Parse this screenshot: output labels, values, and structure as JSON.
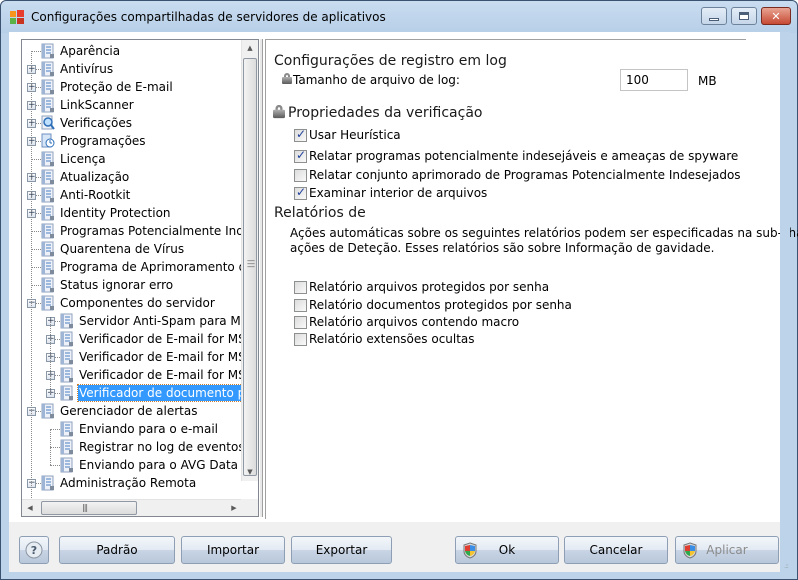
{
  "window": {
    "title": "Configurações compartilhadas de servidores de aplicativos",
    "controls": {
      "minimize": "minimize",
      "maximize": "maximize",
      "close": "close"
    }
  },
  "tree": {
    "items": [
      {
        "label": "Aparência",
        "level": 0,
        "expander": "none",
        "icon": "settings-page-icon"
      },
      {
        "label": "Antivírus",
        "level": 0,
        "expander": "plus",
        "icon": "settings-page-icon"
      },
      {
        "label": "Proteção de E-mail",
        "level": 0,
        "expander": "plus",
        "icon": "settings-page-icon"
      },
      {
        "label": "LinkScanner",
        "level": 0,
        "expander": "plus",
        "icon": "settings-page-icon"
      },
      {
        "label": "Verificações",
        "level": 0,
        "expander": "plus",
        "icon": "magnifier-icon"
      },
      {
        "label": "Programações",
        "level": 0,
        "expander": "plus",
        "icon": "schedule-icon"
      },
      {
        "label": "Licença",
        "level": 0,
        "expander": "none",
        "icon": "settings-page-icon"
      },
      {
        "label": "Atualização",
        "level": 0,
        "expander": "plus",
        "icon": "settings-page-icon"
      },
      {
        "label": "Anti-Rootkit",
        "level": 0,
        "expander": "plus",
        "icon": "settings-page-icon"
      },
      {
        "label": "Identity Protection",
        "level": 0,
        "expander": "plus",
        "icon": "settings-page-icon"
      },
      {
        "label": "Programas Potencialmente Indesejados",
        "level": 0,
        "expander": "none",
        "icon": "settings-page-icon"
      },
      {
        "label": "Quarentena de Vírus",
        "level": 0,
        "expander": "none",
        "icon": "settings-page-icon"
      },
      {
        "label": "Programa de Aprimoramento de Produto",
        "level": 0,
        "expander": "none",
        "icon": "settings-page-icon"
      },
      {
        "label": "Status ignorar erro",
        "level": 0,
        "expander": "none",
        "icon": "settings-page-icon"
      },
      {
        "label": "Componentes do servidor",
        "level": 0,
        "expander": "minus",
        "icon": "settings-page-icon"
      },
      {
        "label": "Servidor Anti-Spam para MS Exchange",
        "level": 1,
        "expander": "plus",
        "icon": "settings-page-icon"
      },
      {
        "label": "Verificador de E-mail for MS Exchange",
        "level": 1,
        "expander": "plus",
        "icon": "settings-page-icon"
      },
      {
        "label": "Verificador de E-mail for MS Exchange",
        "level": 1,
        "expander": "plus",
        "icon": "settings-page-icon"
      },
      {
        "label": "Verificador de E-mail for MS Exchange",
        "level": 1,
        "expander": "plus",
        "icon": "settings-page-icon"
      },
      {
        "label": "Verificador de documento para MS SharePoint",
        "level": 1,
        "expander": "plus",
        "icon": "settings-page-icon",
        "selected": true
      },
      {
        "label": "Gerenciador de alertas",
        "level": 0,
        "expander": "minus",
        "icon": "settings-page-icon"
      },
      {
        "label": "Enviando para o e-mail",
        "level": 1,
        "expander": "none",
        "icon": "settings-page-icon"
      },
      {
        "label": "Registrar no log de eventos",
        "level": 1,
        "expander": "none",
        "icon": "settings-page-icon"
      },
      {
        "label": "Enviando para o AVG Data Center",
        "level": 1,
        "expander": "none",
        "icon": "settings-page-icon"
      },
      {
        "label": "Administração Remota",
        "level": 0,
        "expander": "minus",
        "icon": "settings-page-icon"
      }
    ]
  },
  "panel": {
    "log_section": {
      "title": "Configurações de registro em log",
      "log_size_label": "Tamanho de arquivo de log:",
      "log_size_value": "100",
      "log_size_unit": "MB"
    },
    "scan_section": {
      "title": "Propriedades da verificação",
      "options": [
        {
          "label": "Usar Heurística",
          "checked": true
        },
        {
          "label": "Relatar programas potencialmente indesejáveis e ameaças de spyware",
          "checked": true
        },
        {
          "label": "Relatar conjunto aprimorado de Programas Potencialmente Indesejados",
          "checked": false
        },
        {
          "label": "Examinar interior de arquivos",
          "checked": true
        }
      ]
    },
    "reports_section": {
      "title": "Relatórios de",
      "description_line1": "Ações automáticas sobre os seguintes relatórios podem ser especificadas na sub-chave",
      "description_line2": "ações de Deteção. Esses relatórios são sobre Informação de gavidade.",
      "options": [
        {
          "label": "Relatório arquivos protegidos por senha",
          "checked": false
        },
        {
          "label": "Relatório documentos protegidos por senha",
          "checked": false
        },
        {
          "label": "Relatório arquivos contendo macro",
          "checked": false
        },
        {
          "label": "Relatório extensões ocultas",
          "checked": false
        }
      ]
    }
  },
  "footer": {
    "help_label": "?",
    "default_label": "Padrão",
    "import_label": "Importar",
    "export_label": "Exportar",
    "ok_label": "Ok",
    "cancel_label": "Cancelar",
    "apply_label": "Aplicar"
  }
}
